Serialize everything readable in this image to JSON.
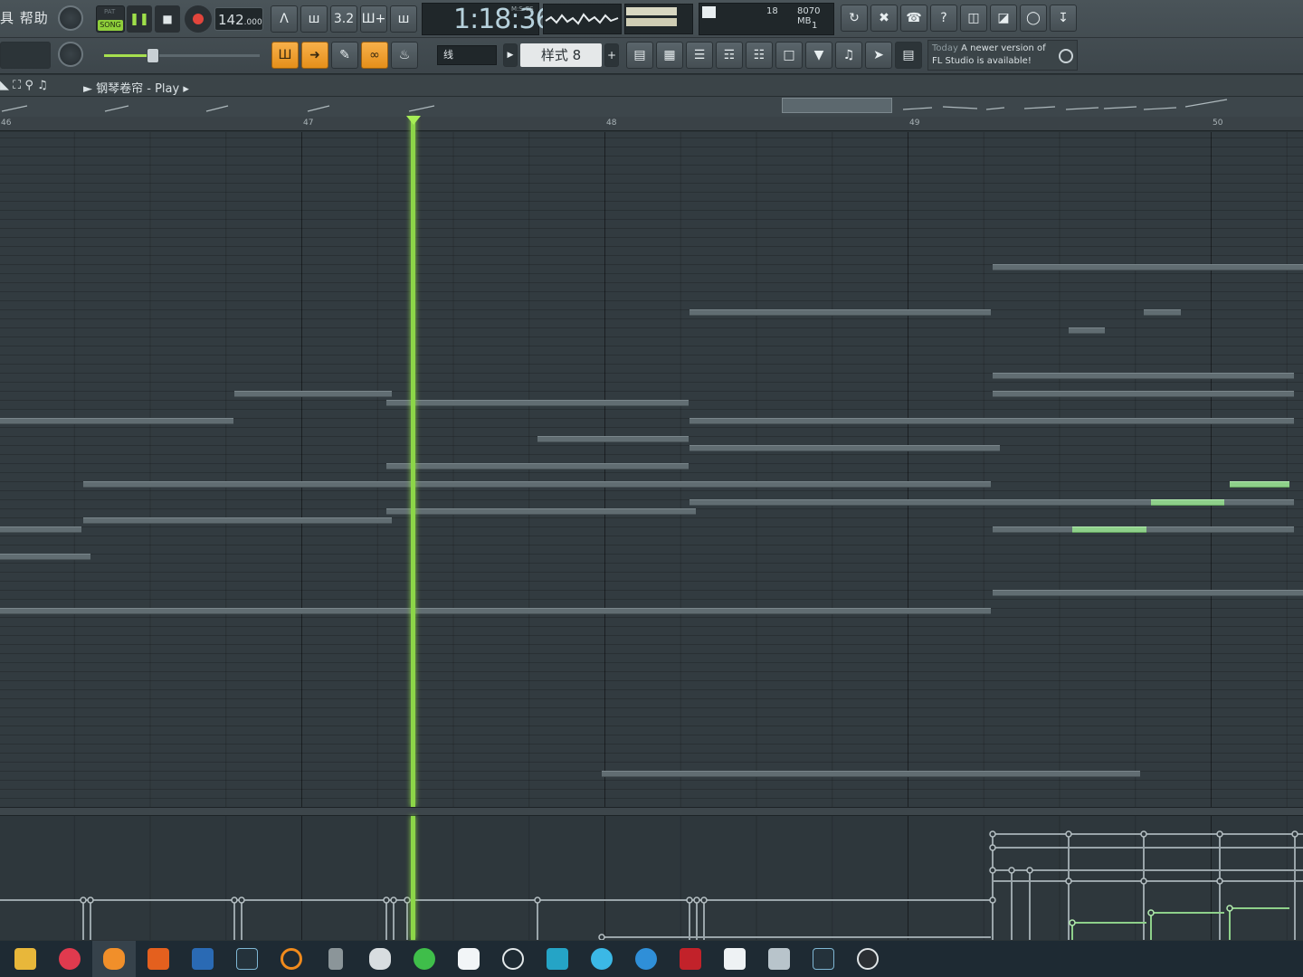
{
  "menu": {
    "text": "具 帮助"
  },
  "transport": {
    "pat_label": "PAT",
    "song_label": "SONG",
    "tempo_main": "142",
    "tempo_decimal": ".000",
    "time": "1:18:36",
    "time_format": "M:S:CS"
  },
  "cpu": {
    "count": "18",
    "memory": "8070 MB",
    "poly": "1"
  },
  "toolbar2": {
    "snap": "线",
    "pattern": "样式 8",
    "news_today": "Today",
    "news_line1": "A newer version of",
    "news_line2": "FL Studio is available!"
  },
  "piano_roll": {
    "title": "钢琴卷帘 - Play",
    "bars": [
      "46",
      "47",
      "48",
      "49",
      "50"
    ],
    "playhead_bar": 47.35
  },
  "taskbar": {
    "icons": [
      "file-explorer-icon",
      "netease-music-icon",
      "fl-studio-icon",
      "studio-app-icon",
      "capcut-icon",
      "nuendo-icon",
      "search-app-icon",
      "storage-icon",
      "gecko-icon",
      "wechat-icon",
      "cloud-icon",
      "openai-icon",
      "screen-share-icon",
      "cluster-icon",
      "snowflake-icon",
      "wavelab-icon",
      "dots-app-icon",
      "photos-icon",
      "nuendo-2-icon",
      "recorder-icon"
    ]
  },
  "colors": {
    "accent_green": "#8cd648",
    "orange_button": "#f7b04a",
    "note": "#616d72",
    "selected_note": "#8ed08a"
  }
}
